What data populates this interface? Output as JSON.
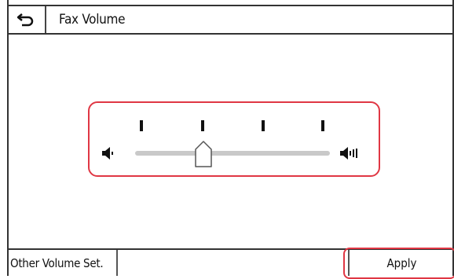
{
  "header": {
    "back_icon": "back-arrow-icon",
    "title": "Fax Volume"
  },
  "volume": {
    "min_icon": "speaker-low-icon",
    "max_icon": "speaker-high-icon",
    "tick_count": 4,
    "level_fraction": 0.35
  },
  "footer": {
    "other_volume_label": "Other Volume Set.",
    "apply_label": "Apply"
  },
  "colors": {
    "highlight": "#e03744",
    "track": "#c9c9c9"
  }
}
